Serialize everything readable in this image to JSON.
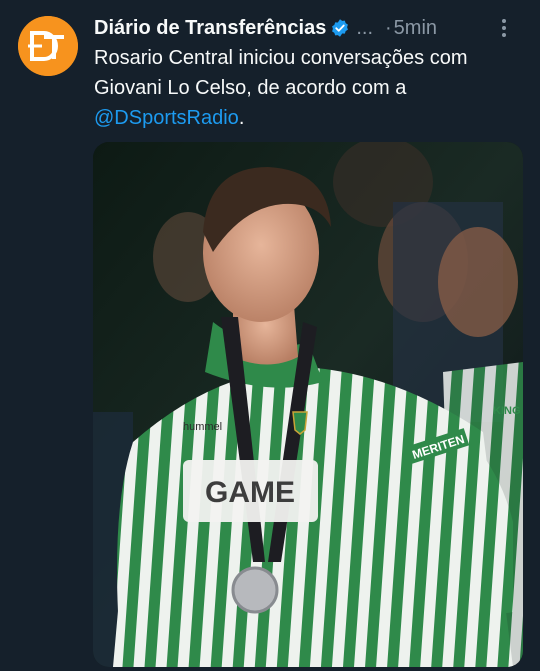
{
  "author": {
    "name": "Diário de Transferências",
    "truncation": "...",
    "separator": "·",
    "time": "5min",
    "avatar_logo": "DT",
    "verified_icon": "verified-badge-icon",
    "more_icon": "more-vertical-icon"
  },
  "tweet": {
    "text_before": "Rosario Central iniciou conversações com Giovani Lo Celso, de acordo com a ",
    "mention": "@DSportsRadio",
    "text_after": "."
  },
  "media": {
    "type": "photo",
    "description_icon": "photo-icon",
    "shirt_sponsor": "GAME",
    "sleeve_text": "MERITEN",
    "brand": "hummel",
    "background_sleeve_text": "KING"
  },
  "colors": {
    "background": "#15202b",
    "text": "#f7f9f9",
    "secondary": "#8b98a5",
    "accent": "#1d9bf0",
    "avatar": "#f7931e",
    "kit_green": "#2f8a4a"
  }
}
